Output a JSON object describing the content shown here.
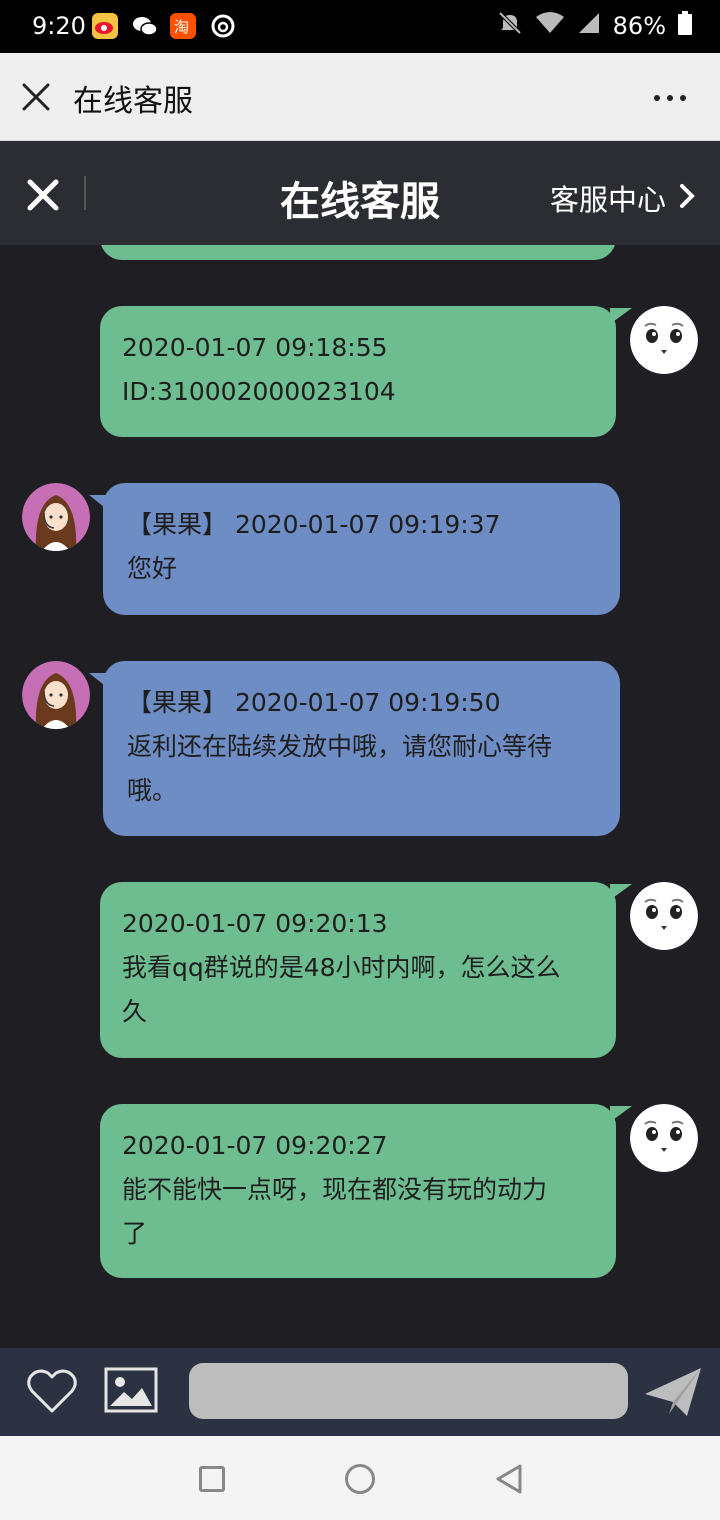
{
  "status_bar": {
    "time": "9:20",
    "battery": "86%",
    "icons": [
      "weibo-icon",
      "wechat-icon",
      "taobao-icon",
      "netease-music-icon",
      "mute-icon",
      "wifi-icon",
      "signal-icon",
      "battery-icon"
    ]
  },
  "webview": {
    "title": "在线客服",
    "close_icon": "close-icon",
    "more_icon": "more-icon"
  },
  "chat_header": {
    "title": "在线客服",
    "service_center": "客服中心"
  },
  "messages": [
    {
      "sender": "user",
      "timestamp": "2020-01-07 09:18:55",
      "lines": [
        "ID:310002000023104"
      ]
    },
    {
      "sender": "agent",
      "agent_name": "【果果】",
      "timestamp": "2020-01-07 09:19:37",
      "lines": [
        "您好"
      ]
    },
    {
      "sender": "agent",
      "agent_name": "【果果】",
      "timestamp": "2020-01-07 09:19:50",
      "lines": [
        "返利还在陆续发放中哦，请您耐心等待",
        "哦。"
      ]
    },
    {
      "sender": "user",
      "timestamp": "2020-01-07 09:20:13",
      "lines": [
        "我看qq群说的是48小时内啊，怎么这么",
        "久"
      ]
    },
    {
      "sender": "user",
      "timestamp": "2020-01-07 09:20:27",
      "lines": [
        "能不能快一点呀，现在都没有玩的动力",
        "了"
      ]
    }
  ],
  "input_bar": {
    "placeholder": "",
    "icons": [
      "heart-icon",
      "image-icon",
      "send-icon"
    ]
  },
  "colors": {
    "user_bubble": "#6dbd91",
    "agent_bubble": "#6d8dc4",
    "chat_background": "#1f1f23",
    "input_bar": "#2d3243"
  }
}
